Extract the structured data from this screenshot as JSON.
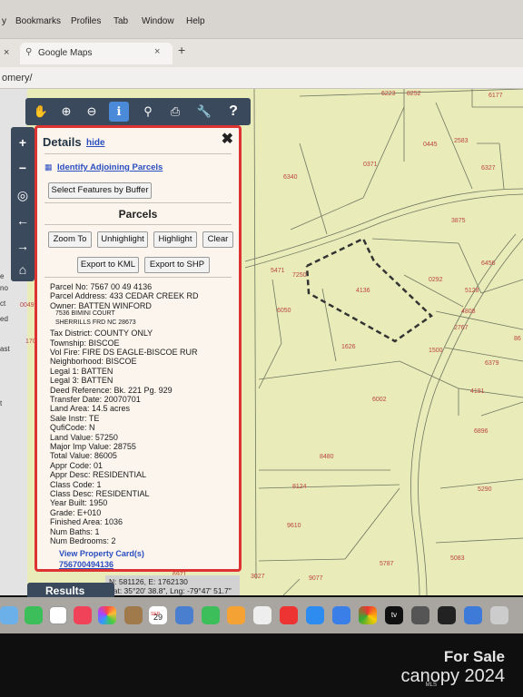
{
  "menubar": {
    "items": [
      "y",
      "Bookmarks",
      "Profiles",
      "Tab",
      "Window",
      "Help"
    ]
  },
  "tabbar": {
    "close_left": "×",
    "tab_title": "Google Maps",
    "tab_close": "×",
    "new_tab": "+"
  },
  "url": {
    "text": "omery/"
  },
  "map_labels": [
    "6223",
    "8252",
    "6177",
    "0445",
    "2583",
    "6327",
    "0371",
    "6340",
    "3875",
    "6456",
    "5471",
    "7250",
    "4136",
    "0292",
    "5128",
    "4808",
    "2767",
    "6050",
    "0049",
    "1701",
    "1626",
    "1500",
    "6379",
    "4191",
    "6002",
    "6896",
    "8480",
    "8124",
    "5290",
    "9610",
    "5083",
    "5787",
    "9077",
    "3027",
    "6971",
    "86"
  ],
  "left_edge_labels": [
    "e",
    "no",
    "ct",
    "ed",
    "ast",
    "t"
  ],
  "details": {
    "title": "Details",
    "hide": "hide",
    "close": "✖",
    "identify": "Identify Adjoining Parcels",
    "select_buffer": "Select Features by Buffer",
    "parcels_heading": "Parcels",
    "buttons": {
      "zoom_to": "Zoom To",
      "unhighlight": "Unhighlight",
      "highlight": "Highlight",
      "clear": "Clear",
      "export_kml": "Export to KML",
      "export_shp": "Export to SHP"
    },
    "lines": [
      "Parcel No: 7567 00 49 4136",
      "Parcel Address: 433 CEDAR CREEK RD",
      "Owner: BATTEN WINFORD",
      "7536 BIMINI COURT",
      "SHERRILLS FRD NC 28673",
      "Tax District: COUNTY ONLY",
      "Township: BISCOE",
      "Vol Fire: FIRE DS EAGLE-BISCOE RUR",
      "Neighborhood: BISCOE",
      "Legal 1: BATTEN",
      "Legal 3: BATTEN",
      "Deed Reference: Bk. 221 Pg. 929",
      "Transfer Date: 20070701",
      "Land Area: 14.5 acres",
      "Sale Instr: TE",
      "QufiCode: N",
      "Land Value: 57250",
      "Major Imp Value: 28755",
      "Total Value: 86005",
      "Appr Code: 01",
      "Appr Desc: RESIDENTIAL",
      "Class Code: 1",
      "Class Desc: RESIDENTIAL",
      "Year Built: 1950",
      "Grade: E+010",
      "Finished Area: 1036",
      "Num Baths: 1",
      "Num Bedrooms: 2"
    ],
    "view_card": "View Property Card(s)",
    "card_link": "756700494136"
  },
  "coords": {
    "line1": "N: 581126, E: 1762130",
    "line2": "Lat: 35°20' 38.8\", Lng: -79°47' 51.7\""
  },
  "results": {
    "label": "Results"
  },
  "dock": {
    "calendar_day": "29",
    "calendar_month": "SEP",
    "tv": "tv"
  },
  "watermark": {
    "line1": "For Sale",
    "line2": "canopy 2024",
    "sub": "MLS"
  }
}
